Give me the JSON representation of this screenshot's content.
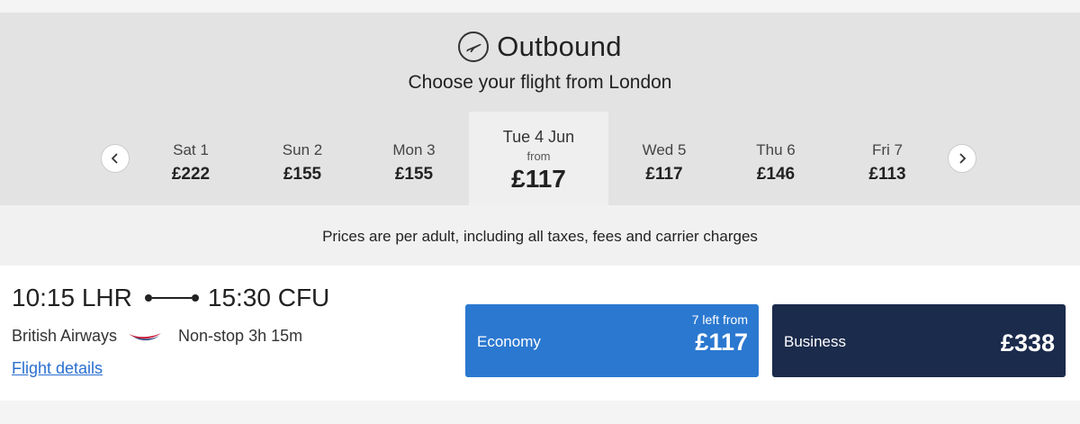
{
  "header": {
    "title": "Outbound",
    "subtitle": "Choose your flight from London",
    "icon": "airplane-takeoff-icon"
  },
  "dates": [
    {
      "label": "Sat 1",
      "price": "£222"
    },
    {
      "label": "Sun 2",
      "price": "£155"
    },
    {
      "label": "Mon 3",
      "price": "£155"
    },
    {
      "label": "Tue 4 Jun",
      "from": "from",
      "price": "£117",
      "selected": true
    },
    {
      "label": "Wed 5",
      "price": "£117"
    },
    {
      "label": "Thu 6",
      "price": "£146"
    },
    {
      "label": "Fri 7",
      "price": "£113"
    }
  ],
  "note": "Prices are per adult, including all taxes, fees and carrier charges",
  "flight": {
    "depart": "10:15 LHR",
    "arrive": "15:30 CFU",
    "airline": "British Airways",
    "stops": "Non-stop 3h 15m",
    "details_link": "Flight details",
    "economy": {
      "name": "Economy",
      "seats_left": "7 left from",
      "price": "£117",
      "color": "#2b78d0"
    },
    "business": {
      "name": "Business",
      "price": "£338",
      "color": "#1b2b4c"
    }
  },
  "colors": {
    "header_bg": "#e3e3e3",
    "link": "#2a6fd0"
  }
}
